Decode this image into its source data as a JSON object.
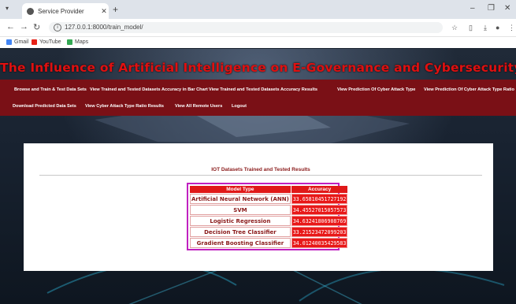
{
  "browser": {
    "tab_title": "Service Provider",
    "url": "127.0.0.1:8000/train_model/",
    "bookmarks": [
      {
        "label": "Gmail",
        "color": "#4285f4"
      },
      {
        "label": "YouTube",
        "color": "#e62117"
      },
      {
        "label": "Maps",
        "color": "#34a853"
      }
    ]
  },
  "page": {
    "title": "The Influence of Artificial Intelligence on E-Governance and Cybersecurity in Smart Cities"
  },
  "menu": [
    "Browse and Train & Test Data Sets",
    "View Trained and Tested Datasets Accuracy in Bar Chart",
    "View Trained and Tested Datasets Accuracy Results",
    "View Prediction Of Cyber Attack Type",
    "View Prediction Of Cyber Attack Type Ratio",
    "Download Predicted Data Sets",
    "View Cyber Attack Type Ratio Results",
    "View All Remote Users",
    "Logout"
  ],
  "results": {
    "heading": "IOT Datasets Trained and Tested Results",
    "columns": [
      "Model Type",
      "Accuracy"
    ],
    "rows": [
      {
        "model": "Artificial Neural Network (ANN)",
        "accuracy": "33.65810451727192"
      },
      {
        "model": "SVM",
        "accuracy": "34.45527015057573"
      },
      {
        "model": "Logistic Regression",
        "accuracy": "34.63241806908769"
      },
      {
        "model": "Decision Tree Classifier",
        "accuracy": "33.21523472099203"
      },
      {
        "model": "Gradient Boosting Classifier",
        "accuracy": "34.01240035429583"
      }
    ]
  }
}
